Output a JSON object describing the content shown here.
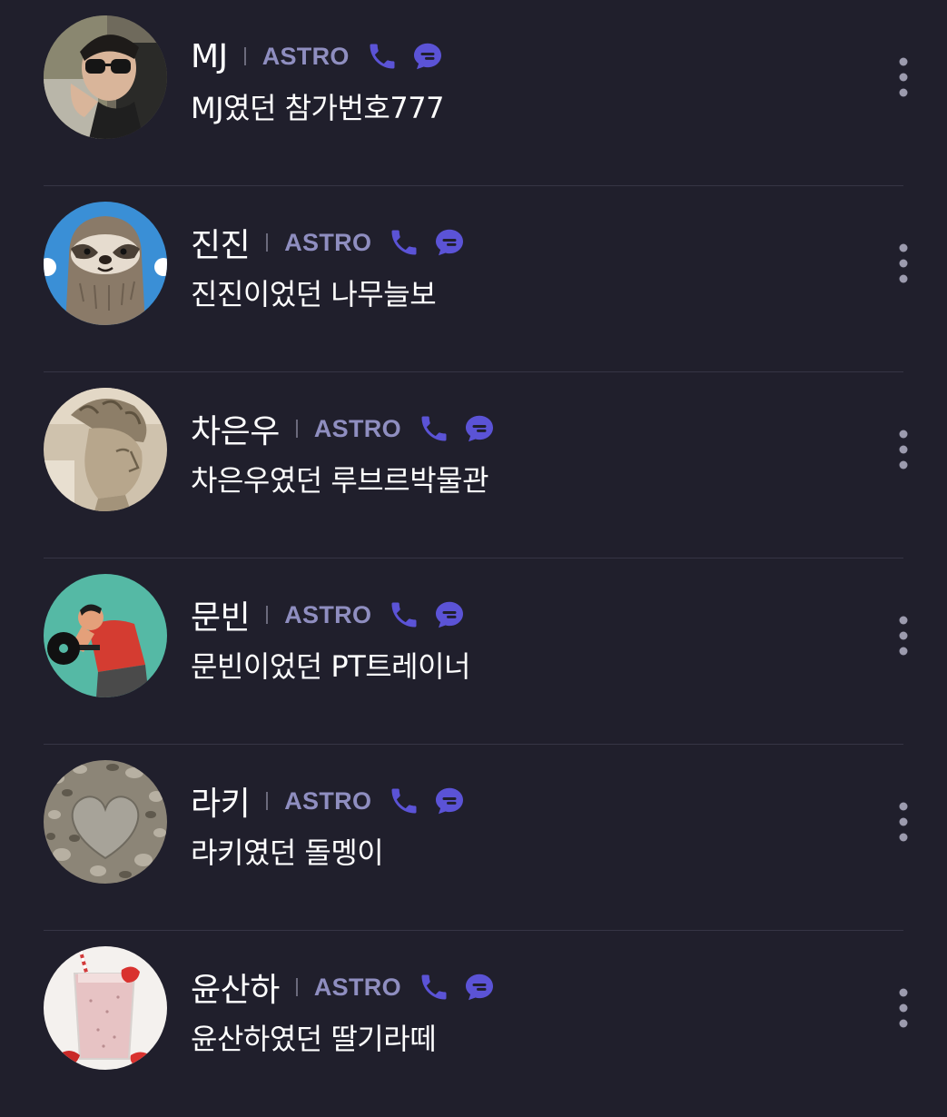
{
  "colors": {
    "background": "#201f2c",
    "divider": "#363545",
    "group_label": "#8f8ec0",
    "accent_icon": "#5b53d6"
  },
  "icons": {
    "call": "phone-icon",
    "chat": "chat-bubble-icon",
    "more": "more-vertical-icon"
  },
  "contacts": [
    {
      "name": "MJ",
      "group": "ASTRO",
      "status": "MJ였던 참가번호777",
      "avatar": "person-with-sunglasses"
    },
    {
      "name": "진진",
      "group": "ASTRO",
      "status": "진진이었던 나무늘보",
      "avatar": "cartoon-sloth"
    },
    {
      "name": "차은우",
      "group": "ASTRO",
      "status": "차은우였던 루브르박물관",
      "avatar": "marble-statue"
    },
    {
      "name": "문빈",
      "group": "ASTRO",
      "status": "문빈이었던 PT트레이너",
      "avatar": "weightlifter"
    },
    {
      "name": "라키",
      "group": "ASTRO",
      "status": "라키였던 돌멩이",
      "avatar": "heart-stone"
    },
    {
      "name": "윤산하",
      "group": "ASTRO",
      "status": "윤산하였던 딸기라떼",
      "avatar": "strawberry-latte"
    }
  ]
}
